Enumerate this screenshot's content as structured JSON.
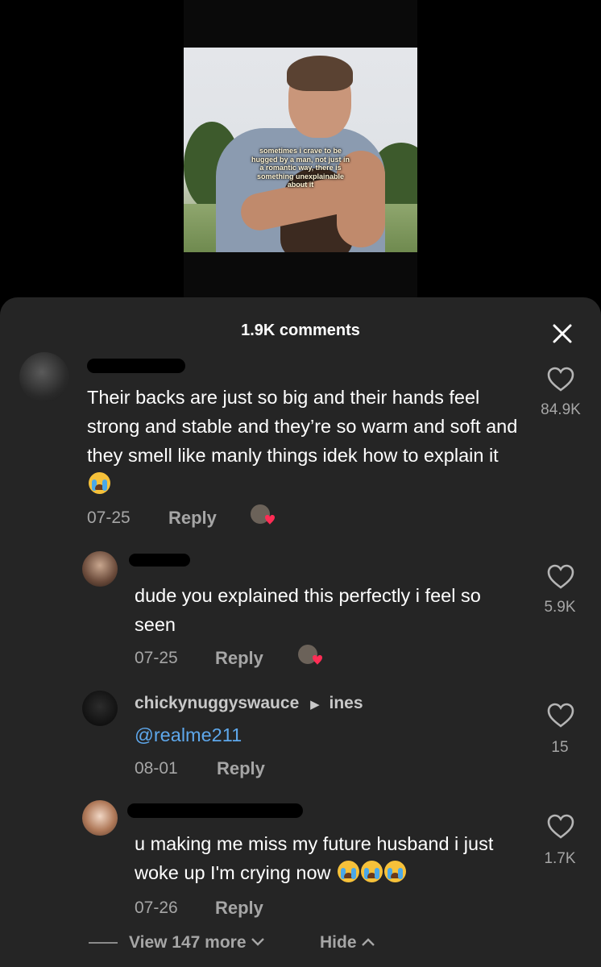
{
  "video": {
    "caption": "sometimes i crave to be hugged by a man, not just in a romantic way, there is something unexplainable about it"
  },
  "sheet": {
    "title": "1.9K comments"
  },
  "comments": [
    {
      "text": "Their backs are just so big and their hands feel strong and stable and they’re so warm and soft and they smell like manly things idek how to explain it",
      "date": "07-25",
      "reply_label": "Reply",
      "likes": "84.9K"
    },
    {
      "text": "dude you explained this perfectly i feel so seen",
      "date": "07-25",
      "reply_label": "Reply",
      "likes": "5.9K"
    },
    {
      "username": "chickynuggyswauce",
      "reply_to": "ines",
      "text": "@realme211",
      "date": "08-01",
      "reply_label": "Reply",
      "likes": "15"
    },
    {
      "text": "u making me miss my future husband i just woke up I'm crying now",
      "date": "07-26",
      "reply_label": "Reply",
      "likes": "1.7K"
    }
  ],
  "footer": {
    "view_more": "View 147 more",
    "hide": "Hide"
  },
  "colors": {
    "sheet_bg": "#252525",
    "muted_text": "#a6a6a6",
    "mention": "#5ea8ec",
    "heart_red": "#ff2d55"
  },
  "icons": [
    "close-icon",
    "heart-outline-icon",
    "creator-liked-icon",
    "crying-emoji-icon",
    "chevron-down-icon",
    "chevron-up-icon",
    "caret-right-icon"
  ]
}
